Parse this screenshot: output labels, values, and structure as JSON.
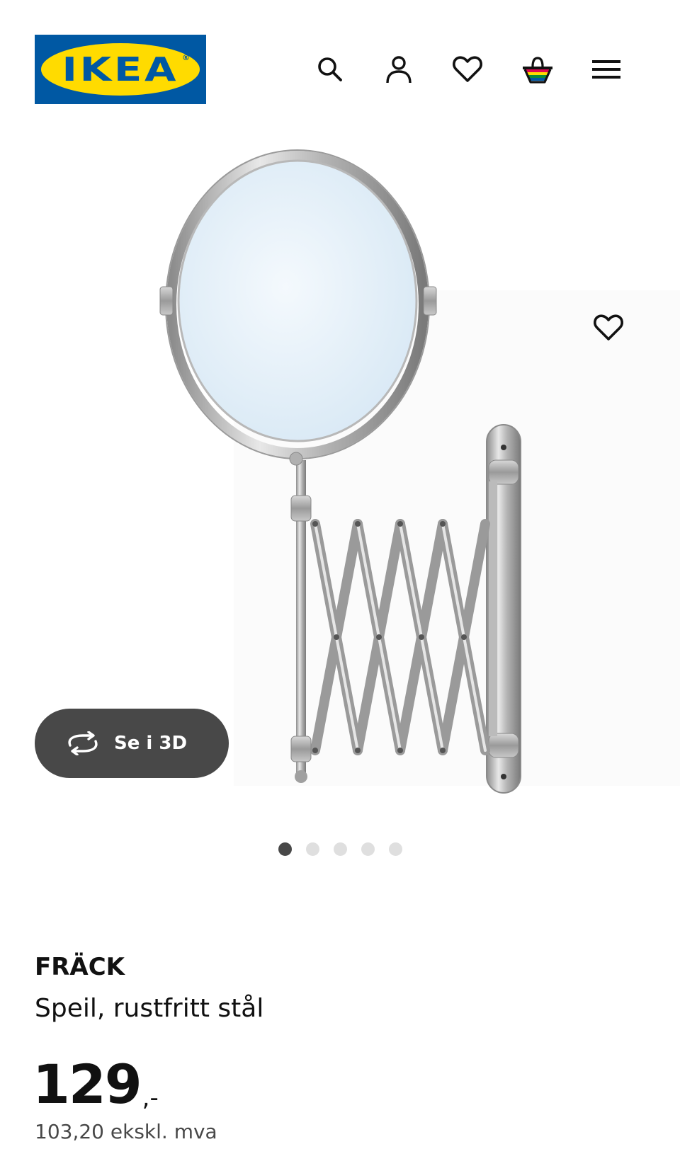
{
  "header": {
    "logo_text": "IKEA",
    "logo_mark": "®",
    "icons": [
      "search-icon",
      "account-icon",
      "heart-icon",
      "basket-icon",
      "menu-icon"
    ]
  },
  "hero": {
    "image_alt": "FRÄCK mirror",
    "favourite_icon": "heart-icon",
    "see_3d_label": "Se i 3D",
    "see_3d_icon": "rotate-icon",
    "carousel": {
      "count": 5,
      "active_index": 0
    }
  },
  "product": {
    "name": "FRÄCK",
    "description": "Speil, rustfritt stål",
    "price_integer": "129",
    "price_decimal": ",-",
    "price_excl_vat": "103,20 ekskl. mva"
  },
  "colors": {
    "ikea_blue": "#0058a3",
    "ikea_yellow": "#ffdb00",
    "button_dark": "#484848",
    "text": "#111111"
  }
}
